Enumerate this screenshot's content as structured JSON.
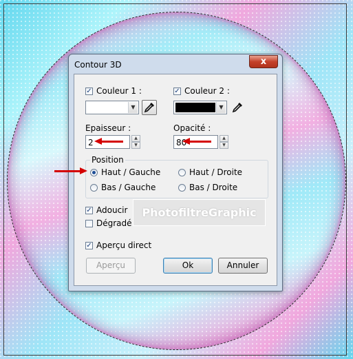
{
  "dialog": {
    "title": "Contour 3D",
    "close_label": "x",
    "couleur1": {
      "label": "Couleur 1 :",
      "checked": true,
      "color": "#ffffff"
    },
    "couleur2": {
      "label": "Couleur 2 :",
      "checked": true,
      "color": "#000000"
    },
    "epaisseur": {
      "label": "Epaisseur :",
      "value": "2"
    },
    "opacite": {
      "label": "Opacité :",
      "value": "80"
    },
    "position": {
      "title": "Position",
      "options": [
        "Haut / Gauche",
        "Haut / Droite",
        "Bas / Gauche",
        "Bas / Droite"
      ],
      "selected": "Haut / Gauche"
    },
    "adoucir": {
      "label": "Adoucir",
      "checked": true
    },
    "degrade": {
      "label": "Dégradé",
      "checked": false
    },
    "apercu_direct": {
      "label": "Aperçu direct",
      "checked": true
    },
    "buttons": {
      "apercu": "Aperçu",
      "ok": "Ok",
      "annuler": "Annuler"
    }
  },
  "watermark": "PhotofiltreGraphic",
  "colors": {
    "annotation_arrow": "#d40000",
    "client_bg": "#f0f0f0",
    "frame": "#cfdcec"
  }
}
